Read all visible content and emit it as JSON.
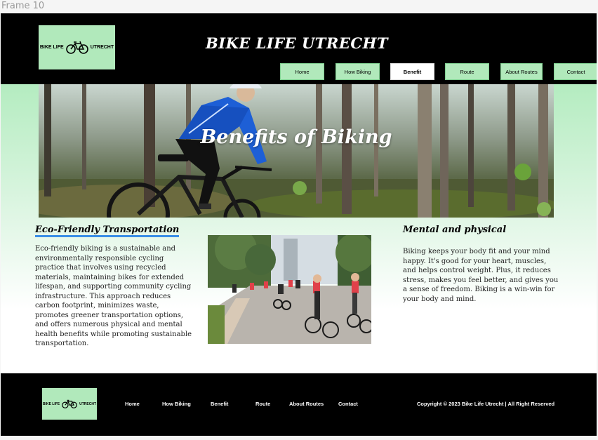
{
  "frame": {
    "label": "Frame 10"
  },
  "header": {
    "logo": {
      "left": "BIKE LIFE",
      "right": "UTRECHT"
    },
    "title": "BIKE LIFE UTRECHT"
  },
  "nav": {
    "items": [
      {
        "label": "Home"
      },
      {
        "label": "How Biking"
      },
      {
        "label": "Benefit",
        "active": true
      },
      {
        "label": "Route"
      },
      {
        "label": "About Routes"
      },
      {
        "label": "Contact"
      }
    ]
  },
  "hero": {
    "title": "Benefits of Biking"
  },
  "left_section": {
    "title": "Eco-Friendly Transportation",
    "text": "Eco-friendly biking is a sustainable and environmentally responsible cycling practice that involves using recycled materials, maintaining bikes for extended lifespan, and supporting community cycling infrastructure. This approach reduces carbon footprint, minimizes waste, promotes greener transportation options, and offers numerous physical and mental health benefits while promoting sustainable transportation."
  },
  "right_section": {
    "title": "Mental and physical",
    "text": "Biking keeps your body fit and your mind happy. It's good for your heart, muscles, and helps control weight. Plus, it reduces stress, makes you feel better, and gives you a sense of freedom. Biking is a win-win for your body and mind."
  },
  "footer": {
    "logo": {
      "left": "BIKE LIFE",
      "right": "UTRECHT"
    },
    "links": [
      {
        "label": "Home"
      },
      {
        "label": "How Biking"
      },
      {
        "label": "Benefit"
      },
      {
        "label": "Route"
      },
      {
        "label": "About Routes"
      },
      {
        "label": "Contact"
      }
    ],
    "copyright": "Copyright  © 2023 Bike Life Utrecht | All Right Reserved"
  },
  "colors": {
    "accent_green": "#b1e9bb",
    "header_bg": "#000000",
    "underline_blue": "#3a8ee6"
  }
}
